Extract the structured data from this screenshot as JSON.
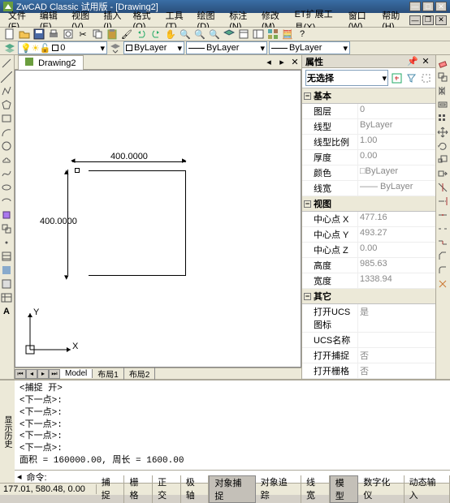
{
  "window": {
    "title": "ZwCAD Classic 试用版 - [Drawing2]"
  },
  "menu": [
    "文件(F)",
    "编辑(E)",
    "视图(V)",
    "插入(I)",
    "格式(O)",
    "工具(T)",
    "绘图(D)",
    "标注(N)",
    "修改(M)",
    "ET扩展工具(X)",
    "窗口(W)",
    "帮助(H)"
  ],
  "doc_tab": "Drawing2",
  "layer": {
    "bylayer": "ByLayer",
    "bylayer2": "ByLayer",
    "bylayer3": "ByLayer"
  },
  "drawing": {
    "dim_h": "400.0000",
    "dim_v": "400.0000",
    "axis_x": "X",
    "axis_y": "Y"
  },
  "model_tabs": {
    "model": "Model",
    "layout1": "布局1",
    "layout2": "布局2"
  },
  "prop_panel": {
    "title": "属性",
    "selection": "无选择",
    "cats": {
      "basic": "基本",
      "view": "视图",
      "other": "其它"
    },
    "basic": [
      {
        "k": "图层",
        "v": "0"
      },
      {
        "k": "线型",
        "v": "ByLayer"
      },
      {
        "k": "线型比例",
        "v": "1.00"
      },
      {
        "k": "厚度",
        "v": "0.00"
      },
      {
        "k": "颜色",
        "v": "□ByLayer"
      },
      {
        "k": "线宽",
        "v": "—— ByLayer"
      }
    ],
    "view": [
      {
        "k": "中心点 X",
        "v": "477.16"
      },
      {
        "k": "中心点 Y",
        "v": "493.27"
      },
      {
        "k": "中心点 Z",
        "v": "0.00"
      },
      {
        "k": "高度",
        "v": "985.63"
      },
      {
        "k": "宽度",
        "v": "1338.94"
      }
    ],
    "other": [
      {
        "k": "打开UCS图标",
        "v": "是"
      },
      {
        "k": "UCS名称",
        "v": ""
      },
      {
        "k": "打开捕捉",
        "v": "否"
      },
      {
        "k": "打开栅格",
        "v": "否"
      }
    ]
  },
  "cmd": {
    "side": "显示历史",
    "history": "<捕捉 开>\n<下一点>:\n<下一点>:\n<下一点>:\n<下一点>:\n<下一点>:\n面积 = 160000.00, 周长 = 1600.00",
    "prompt": "命令:"
  },
  "status": {
    "coord": "177.01, 580.48, 0.00",
    "btns": [
      "捕捉",
      "栅格",
      "正交",
      "极轴",
      "对象捕捉",
      "对象追踪",
      "线宽",
      "模型",
      "数字化仪",
      "动态输入"
    ],
    "on": [
      4,
      7
    ]
  }
}
